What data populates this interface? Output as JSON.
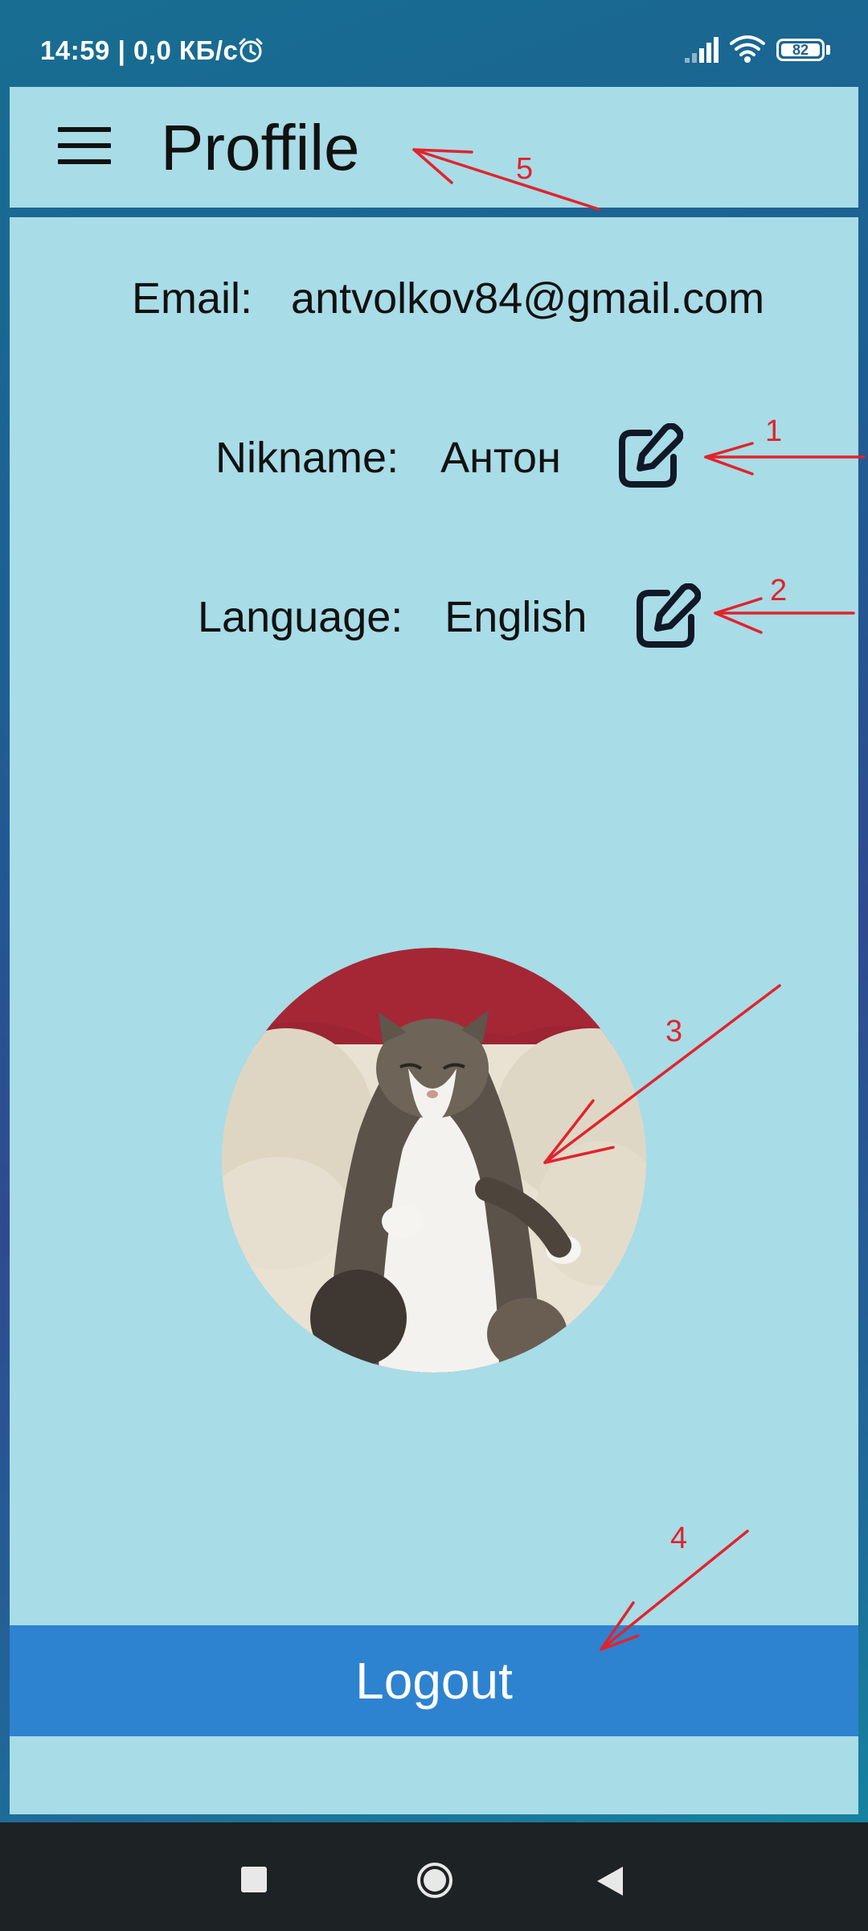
{
  "status_bar": {
    "text": "14:59 | 0,0 КБ/с",
    "battery": "82",
    "icons": [
      "alarm-icon",
      "signal-icon",
      "wifi-icon",
      "battery-icon"
    ]
  },
  "app_bar": {
    "menu_icon": "menu-icon",
    "title": "Proffile"
  },
  "profile": {
    "email_label": "Email:",
    "email_value": "antvolkov84@gmail.com",
    "nickname_label": "Nikname:",
    "nickname_value": "Антон",
    "language_label": "Language:",
    "language_value": "English",
    "edit_icon": "edit-icon",
    "avatar_description": "cat-photo"
  },
  "logout_label": "Logout",
  "annotations": {
    "color": "#e0242c",
    "numbers": [
      "1",
      "2",
      "3",
      "4",
      "5"
    ]
  },
  "nav_bar": {
    "icons": [
      "recents-icon",
      "home-icon",
      "back-icon"
    ]
  },
  "colors": {
    "panel_bg": "#a8dce7",
    "logout_bg": "#2d83d0",
    "text": "#111111"
  }
}
